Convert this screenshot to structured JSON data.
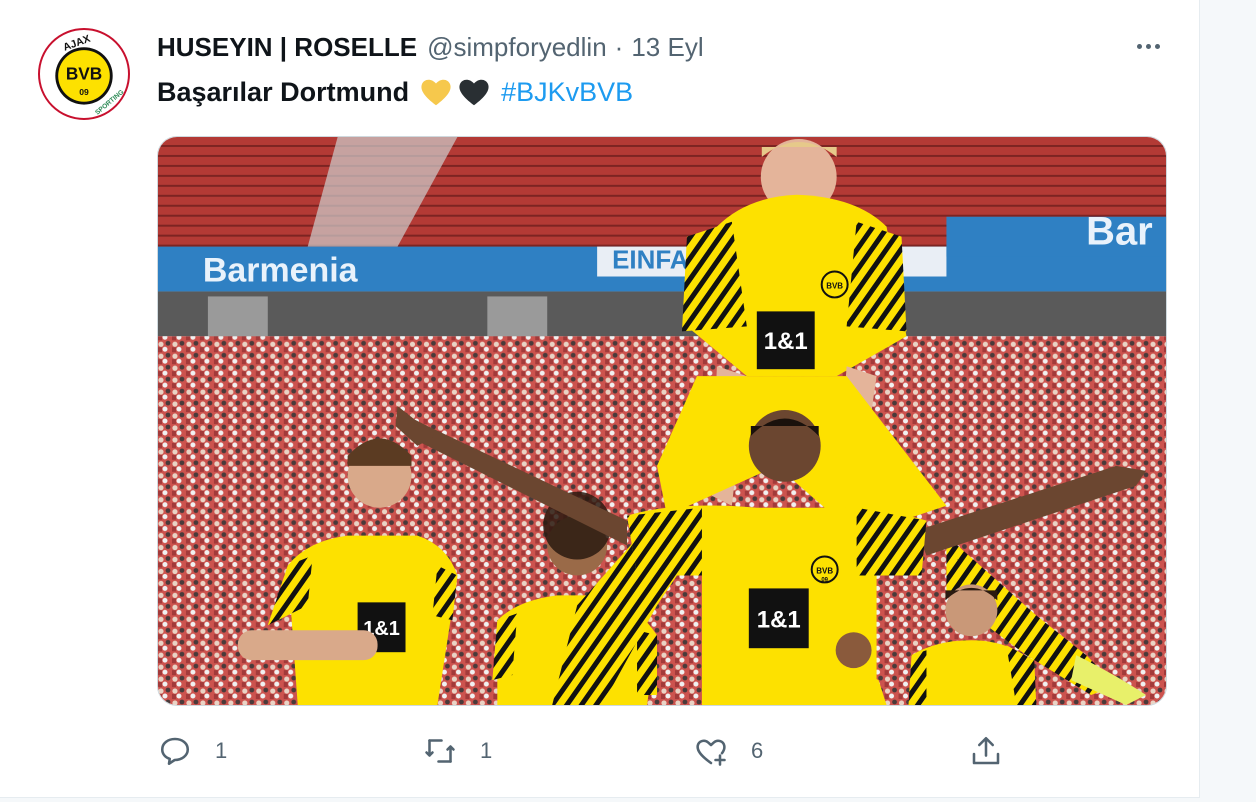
{
  "tweet": {
    "author": {
      "display_name": "HUSEYIN | ROSELLE",
      "handle": "@simpforyedlin",
      "avatar_text_top": "AJAX",
      "avatar_text_center": "BVB",
      "avatar_text_number": "09",
      "avatar_text_bottom": "SPORTING"
    },
    "separator": "·",
    "date": "13 Eyl",
    "text": "Başarılar Dortmund",
    "emojis": [
      "yellow-heart",
      "black-heart"
    ],
    "hashtag": "#BJKvBVB",
    "media": {
      "banner_text_left": "Barmenia",
      "banner_text_mid": "EINFAC",
      "banner_text_right": "Bar",
      "sponsor_text": "1&1",
      "crest_text": "BVB",
      "crest_number": "09"
    },
    "actions": {
      "reply_count": "1",
      "retweet_count": "1",
      "like_count": "6"
    }
  },
  "colors": {
    "text_primary": "#0f1419",
    "text_secondary": "#536471",
    "link": "#1d9bf0",
    "bvb_yellow": "#fde100",
    "bvb_black": "#000000"
  },
  "icons": {
    "more": "more-horizontal-icon",
    "reply": "reply-icon",
    "retweet": "retweet-icon",
    "like": "like-icon",
    "share": "share-icon"
  }
}
